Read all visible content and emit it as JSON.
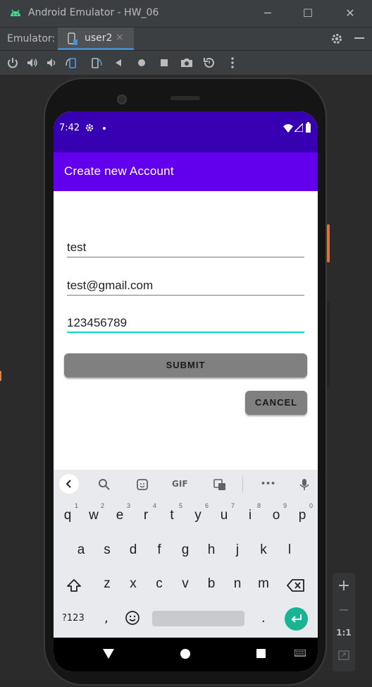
{
  "window": {
    "title": "Android Emulator - HW_06",
    "minimize_glyph": "─",
    "maximize_glyph": "☐",
    "close_glyph": "✕"
  },
  "tabbar": {
    "emulator_label": "Emulator:",
    "tab_label": "user2",
    "tab_close": "×"
  },
  "zoom": {
    "plus": "+",
    "minus": "−",
    "one_to_one": "1:1"
  },
  "status_bar": {
    "time": "7:42"
  },
  "app": {
    "title": "Create new Account",
    "fields": {
      "name": "test",
      "email": "test@gmail.com",
      "password": "123456789"
    },
    "submit_label": "SUBMIT",
    "cancel_label": "CANCEL"
  },
  "keyboard": {
    "toolbar": {
      "gif": "GIF",
      "more": "•••"
    },
    "row1": [
      {
        "k": "q",
        "h": "1"
      },
      {
        "k": "w",
        "h": "2"
      },
      {
        "k": "e",
        "h": "3"
      },
      {
        "k": "r",
        "h": "4"
      },
      {
        "k": "t",
        "h": "5"
      },
      {
        "k": "y",
        "h": "6"
      },
      {
        "k": "u",
        "h": "7"
      },
      {
        "k": "i",
        "h": "8"
      },
      {
        "k": "o",
        "h": "9"
      },
      {
        "k": "p",
        "h": "0"
      }
    ],
    "row2": [
      "a",
      "s",
      "d",
      "f",
      "g",
      "h",
      "j",
      "k",
      "l"
    ],
    "row3": [
      "z",
      "x",
      "c",
      "v",
      "b",
      "n",
      "m"
    ],
    "symbols_key": "?123",
    "comma_key": ",",
    "period_key": "."
  },
  "colors": {
    "status_bar": "#3700b3",
    "app_bar": "#6200ee",
    "focus_underline": "#03dac5",
    "button": "#808080",
    "enter_key": "#1ab394",
    "tab_underline": "#4a88c7"
  }
}
